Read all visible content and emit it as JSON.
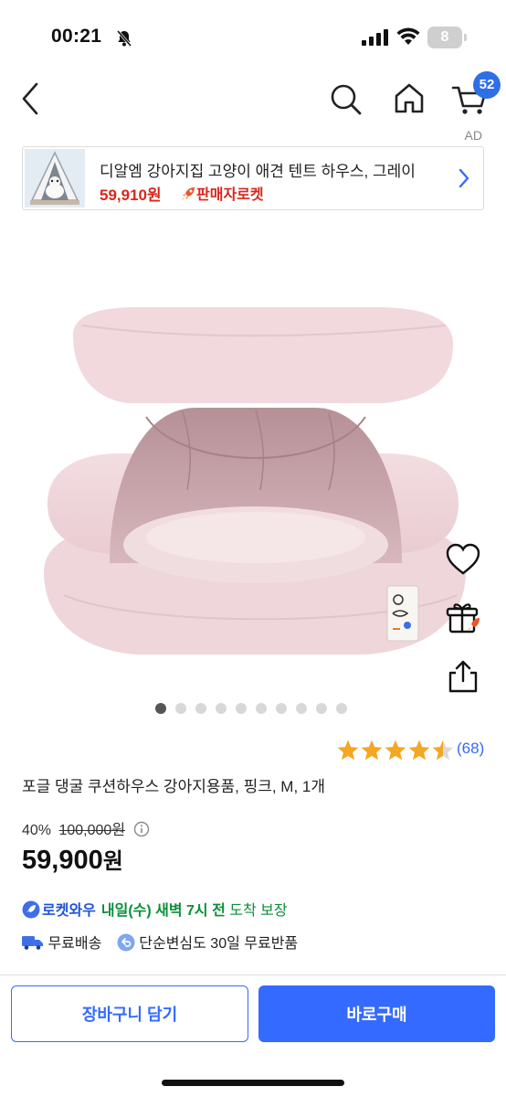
{
  "status_bar": {
    "time": "00:21",
    "battery": "8"
  },
  "nav": {
    "cart_count": "52"
  },
  "ad": {
    "label": "AD",
    "title": "디알엠 강아지집 고양이 애견 텐트 하우스, 그레이",
    "price": "59,910원",
    "badge": "판매자로켓"
  },
  "gallery": {
    "image_count": 10,
    "active_index": 0
  },
  "rating": {
    "stars": 4.5,
    "count": "(68)"
  },
  "product": {
    "title": "포글 댕굴 쿠션하우스 강아지용품, 핑크, M, 1개",
    "discount": "40%",
    "original_price": "100,000원",
    "sale_price": "59,900",
    "currency": "원"
  },
  "delivery": {
    "badge": "로켓와우",
    "date": "내일(수) 새벽 7시 전",
    "suffix": "도착 보장",
    "shipping": "무료배송",
    "returns": "단순변심도 30일 무료반품"
  },
  "actions": {
    "cart_button": "장바구니 담기",
    "buy_button": "바로구매"
  },
  "colors": {
    "accent": "#346aff",
    "price_red": "#d8261c",
    "delivery_green": "#0a8f38",
    "badge_blue": "#2f6fe6"
  }
}
